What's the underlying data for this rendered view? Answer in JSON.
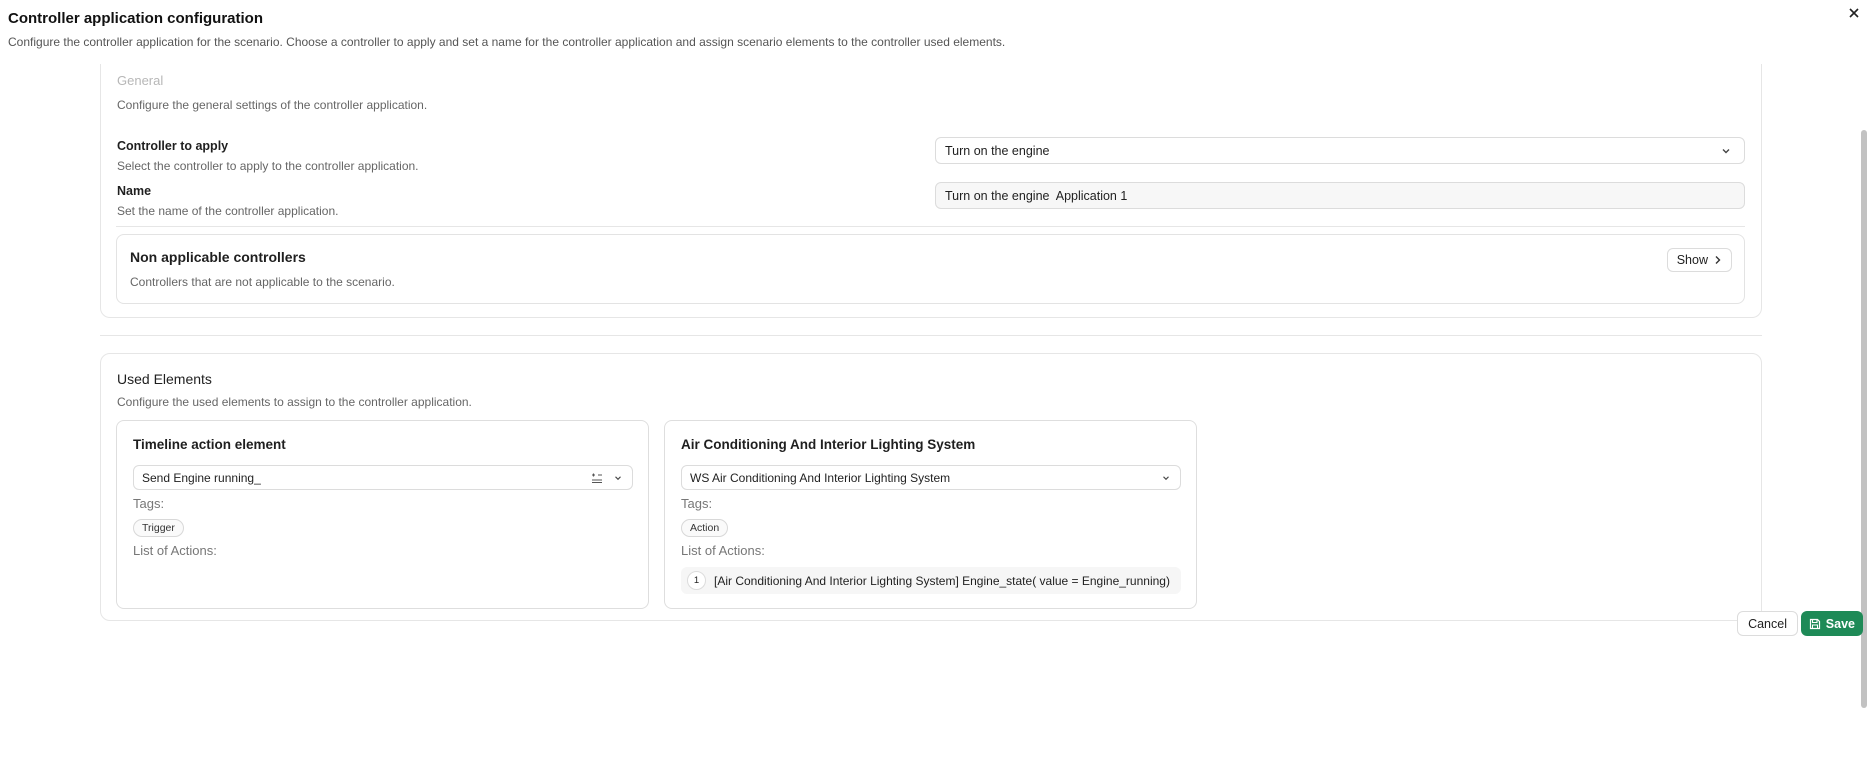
{
  "dialog": {
    "title": "Controller application configuration",
    "subtitle": "Configure the controller application for the scenario. Choose a controller to apply and set a name for the controller application and assign scenario elements to the controller used elements.",
    "close_icon": "close-icon"
  },
  "general": {
    "title": "General",
    "description": "Configure the general settings of the controller application.",
    "controller_field": {
      "label": "Controller to apply",
      "help": "Select the controller to apply to the controller application.",
      "value": "Turn on the engine"
    },
    "name_field": {
      "label": "Name",
      "help": "Set the name of the controller application.",
      "value": "Turn on the engine  Application 1"
    },
    "non_applicable": {
      "title": "Non applicable controllers",
      "description": "Controllers that are not applicable to the scenario.",
      "show_label": "Show"
    }
  },
  "used_elements": {
    "title": "Used Elements",
    "description": "Configure the used elements to assign to the controller application.",
    "cards": [
      {
        "title": "Timeline action element",
        "selected": "Send Engine running_",
        "tags_label": "Tags:",
        "tag": "Trigger",
        "actions_label": "List of Actions:",
        "actions": []
      },
      {
        "title": "Air Conditioning And Interior Lighting System",
        "selected": "WS Air Conditioning And Interior Lighting System",
        "tags_label": "Tags:",
        "tag": "Action",
        "actions_label": "List of Actions:",
        "actions": [
          {
            "index": "1",
            "text": "[Air Conditioning And Interior Lighting System] Engine_state( value = Engine_running)"
          }
        ]
      }
    ]
  },
  "footer": {
    "cancel_label": "Cancel",
    "save_label": "Save"
  },
  "colors": {
    "primary": "#1e8a57",
    "border": "#dcdcdc"
  }
}
